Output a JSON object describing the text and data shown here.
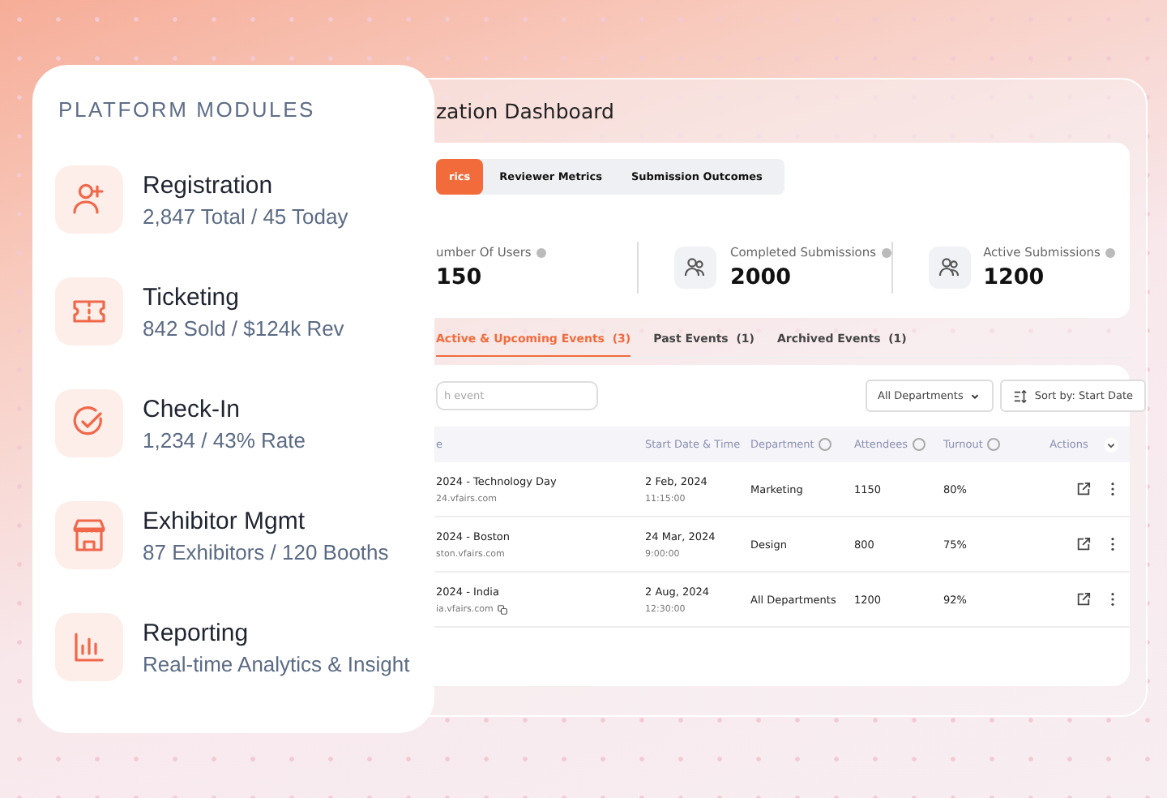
{
  "modules_card": {
    "title": "PLATFORM MODULES",
    "modules": [
      {
        "title": "Registration",
        "subtitle": "2,847 Total / 45 Today"
      },
      {
        "title": "Ticketing",
        "subtitle": "842 Sold / $124k Rev"
      },
      {
        "title": "Check-In",
        "subtitle": "1,234 / 43% Rate"
      },
      {
        "title": "Exhibitor Mgmt",
        "subtitle": "87 Exhibitors / 120 Booths"
      },
      {
        "title": "Reporting",
        "subtitle": "Real-time Analytics & Insight"
      }
    ]
  },
  "dashboard": {
    "title": "zation Dashboard",
    "tabs": [
      {
        "label": "rics",
        "selected": true
      },
      {
        "label": "Reviewer Metrics",
        "selected": false
      },
      {
        "label": "Submission Outcomes",
        "selected": false
      }
    ],
    "stats": [
      {
        "label": "umber Of Users",
        "value": "150",
        "icon_visible": false
      },
      {
        "label": "Completed Submissions",
        "value": "2000",
        "icon_visible": true
      },
      {
        "label": "Active Submissions",
        "value": "1200",
        "icon_visible": true
      }
    ],
    "event_tabs": [
      {
        "label": "Active & Upcoming Events",
        "count": "(3)",
        "selected": true
      },
      {
        "label": "Past Events",
        "count": "(1)",
        "selected": false
      },
      {
        "label": "Archived Events",
        "count": "(1)",
        "selected": false
      }
    ],
    "search": {
      "placeholder": "h event"
    },
    "department_filter": "All Departments",
    "sort_button": "Sort by: Start Date",
    "table": {
      "columns": [
        {
          "label": "e",
          "help": false
        },
        {
          "label": "Start Date & Time",
          "help": false
        },
        {
          "label": "Department",
          "help": true
        },
        {
          "label": "Attendees",
          "help": true
        },
        {
          "label": "Turnout",
          "help": true
        },
        {
          "label": "Actions",
          "help": false
        }
      ],
      "rows": [
        {
          "name": "2024 - Technology Day",
          "url": "24.vfairs.com",
          "copyable": false,
          "date": "2 Feb, 2024",
          "time": "11:15:00",
          "department": "Marketing",
          "attendees": "1150",
          "turnout": "80%"
        },
        {
          "name": "2024 - Boston",
          "url": "ston.vfairs.com",
          "copyable": false,
          "date": "24 Mar, 2024",
          "time": "9:00:00",
          "department": "Design",
          "attendees": "800",
          "turnout": "75%"
        },
        {
          "name": "2024 - India",
          "url": "ia.vfairs.com",
          "copyable": true,
          "date": "2 Aug, 2024",
          "time": "12:30:00",
          "department": "All Departments",
          "attendees": "1200",
          "turnout": "92%"
        }
      ]
    }
  }
}
